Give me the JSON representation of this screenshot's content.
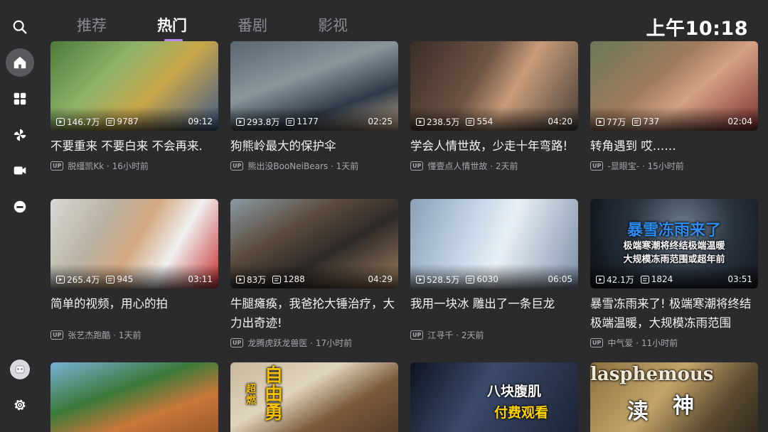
{
  "status_bar": {
    "clock": "上午10:18"
  },
  "tabs": [
    {
      "label": "推荐"
    },
    {
      "label": "热门"
    },
    {
      "label": "番剧"
    },
    {
      "label": "影视"
    }
  ],
  "active_tab": "热门",
  "accent_color": "#b388f5",
  "sidebar": {
    "items": [
      {
        "icon": "search-icon"
      },
      {
        "icon": "home-icon"
      },
      {
        "icon": "grid-icon"
      },
      {
        "icon": "pinwheel-icon"
      },
      {
        "icon": "video-camera-icon"
      },
      {
        "icon": "live-icon"
      },
      {
        "icon": "avatar"
      },
      {
        "icon": "gear-icon"
      }
    ]
  },
  "videos": [
    {
      "views": "146.7万",
      "danmaku": "9787",
      "duration": "09:12",
      "title": "不要重来 不要白来 不会再来.",
      "uploader": "脱缰凯Kk",
      "time": "16小时前"
    },
    {
      "views": "293.8万",
      "danmaku": "1177",
      "duration": "02:25",
      "title": "狗熊岭最大的保护伞",
      "uploader": "熊出没BooNeiBears",
      "time": "1天前"
    },
    {
      "views": "238.5万",
      "danmaku": "554",
      "duration": "04:20",
      "title": "学会人情世故，少走十年弯路!",
      "uploader": "懂壹点人情世故",
      "time": "2天前"
    },
    {
      "views": "77万",
      "danmaku": "737",
      "duration": "02:04",
      "title": "转角遇到 哎……",
      "uploader": "-显眼宝-",
      "time": "15小时前"
    },
    {
      "views": "265.4万",
      "danmaku": "945",
      "duration": "03:11",
      "title": "简单的视频，用心的拍",
      "uploader": "张艺杰跑酷",
      "time": "1天前"
    },
    {
      "views": "83万",
      "danmaku": "1288",
      "duration": "04:29",
      "title": "牛腿瘫痪，我爸抡大锤治疗，大力出奇迹!",
      "uploader": "龙腾虎跃龙兽医",
      "time": "17小时前"
    },
    {
      "views": "528.5万",
      "danmaku": "6030",
      "duration": "06:05",
      "title": "我用一块冰 雕出了一条巨龙",
      "uploader": "江寻千",
      "time": "2天前"
    },
    {
      "views": "42.1万",
      "danmaku": "1824",
      "duration": "03:51",
      "title": "暴雪冻雨来了! 极端寒潮将终结极端温暖，大规模冻雨范围",
      "uploader": "中气爱",
      "time": "11小时前",
      "overlay": [
        "暴雪冻雨来了",
        "极端寒潮将终结极端温暖",
        "大规模冻雨范围或超年前"
      ]
    },
    {
      "overlay": []
    },
    {
      "overlay": [
        "自",
        "由",
        "勇",
        "超",
        "燃"
      ]
    },
    {
      "overlay": [
        "八块腹肌",
        "付费观看"
      ]
    },
    {
      "overlay": [
        "lasphemous",
        "渎",
        "神"
      ]
    }
  ]
}
